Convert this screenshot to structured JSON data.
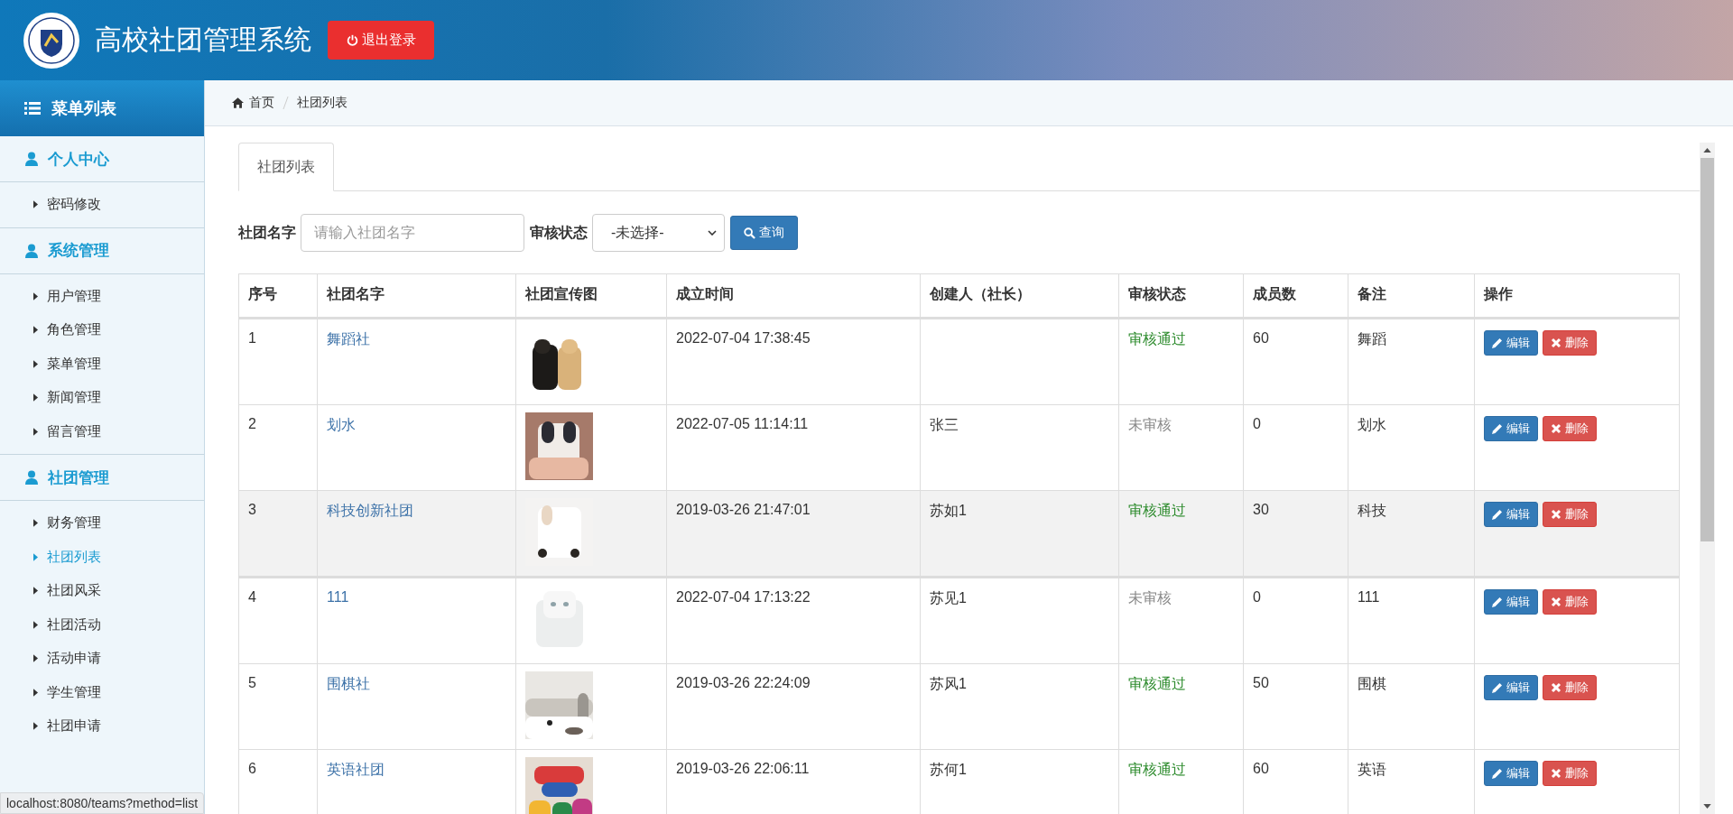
{
  "header": {
    "title": "高校社团管理系统",
    "logout_button": "退出登录"
  },
  "sidebar": {
    "title": "菜单列表",
    "groups": [
      {
        "title": "个人中心",
        "items": [
          {
            "label": "密码修改",
            "selected": false
          }
        ]
      },
      {
        "title": "系统管理",
        "items": [
          {
            "label": "用户管理",
            "selected": false
          },
          {
            "label": "角色管理",
            "selected": false
          },
          {
            "label": "菜单管理",
            "selected": false
          },
          {
            "label": "新闻管理",
            "selected": false
          },
          {
            "label": "留言管理",
            "selected": false
          }
        ]
      },
      {
        "title": "社团管理",
        "items": [
          {
            "label": "财务管理",
            "selected": false
          },
          {
            "label": "社团列表",
            "selected": true
          },
          {
            "label": "社团风采",
            "selected": false
          },
          {
            "label": "社团活动",
            "selected": false
          },
          {
            "label": "活动申请",
            "selected": false
          },
          {
            "label": "学生管理",
            "selected": false
          },
          {
            "label": "社团申请",
            "selected": false
          }
        ]
      }
    ]
  },
  "breadcrumb": [
    "首页",
    "社团列表"
  ],
  "tabs": [
    {
      "label": "社团列表",
      "selected": true
    }
  ],
  "search": {
    "name_label": "社团名字",
    "name_placeholder": "请输入社团名字",
    "status_label": "审核状态",
    "status_value": "-未选择-",
    "button": "查询"
  },
  "table": {
    "columns": [
      "序号",
      "社团名字",
      "社团宣传图",
      "成立时间",
      "创建人（社长）",
      "审核状态",
      "成员数",
      "备注",
      "操作"
    ],
    "rows": [
      {
        "index": "1",
        "name": "舞蹈社",
        "founded": "2022-07-04 17:38:45",
        "creator": "",
        "status": "审核通过",
        "approved": true,
        "members": "60",
        "note": "舞蹈",
        "highlighted": false,
        "edit": "编辑",
        "delete": "删除"
      },
      {
        "index": "2",
        "name": "划水",
        "founded": "2022-07-05 11:14:11",
        "creator": "张三",
        "status": "未审核",
        "approved": false,
        "members": "0",
        "note": "划水",
        "highlighted": false,
        "edit": "编辑",
        "delete": "删除"
      },
      {
        "index": "3",
        "name": "科技创新社团",
        "founded": "2019-03-26 21:47:01",
        "creator": "苏如1",
        "status": "审核通过",
        "approved": true,
        "members": "30",
        "note": "科技",
        "highlighted": true,
        "edit": "编辑",
        "delete": "删除"
      },
      {
        "index": "4",
        "name": "111",
        "founded": "2022-07-04 17:13:22",
        "creator": "苏见1",
        "status": "未审核",
        "approved": false,
        "members": "0",
        "note": "111",
        "highlighted": false,
        "edit": "编辑",
        "delete": "删除"
      },
      {
        "index": "5",
        "name": "围棋社",
        "founded": "2019-03-26 22:24:09",
        "creator": "苏风1",
        "status": "审核通过",
        "approved": true,
        "members": "50",
        "note": "围棋",
        "highlighted": false,
        "edit": "编辑",
        "delete": "删除"
      },
      {
        "index": "6",
        "name": "英语社团",
        "founded": "2019-03-26 22:06:11",
        "creator": "苏何1",
        "status": "审核通过",
        "approved": true,
        "members": "60",
        "note": "英语",
        "highlighted": false,
        "edit": "编辑",
        "delete": "删除"
      }
    ]
  },
  "status_bar": "localhost:8080/teams?method=list"
}
